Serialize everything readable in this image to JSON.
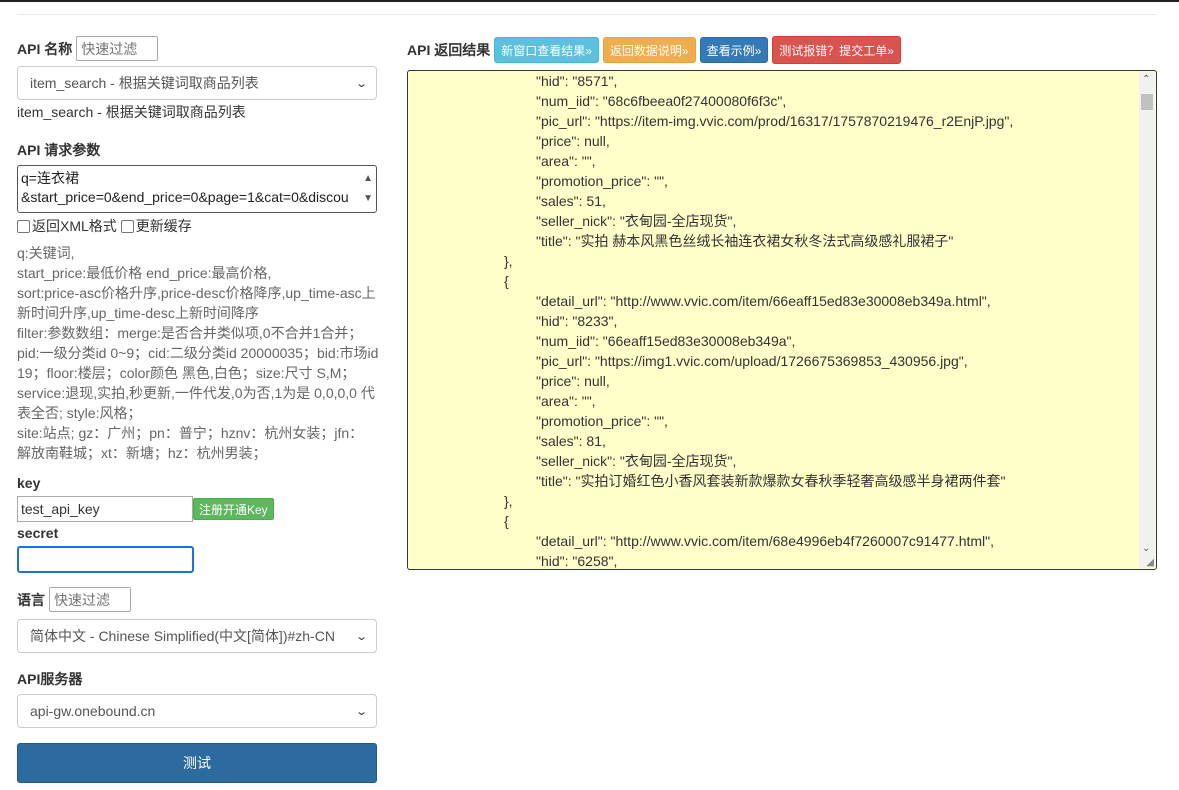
{
  "api_name": {
    "label": "API 名称",
    "filter_placeholder": "快速过滤",
    "selected": "item_search - 根据关键词取商品列表",
    "description": "item_search - 根据关键词取商品列表"
  },
  "request_params": {
    "label": "API 请求参数",
    "line1": "q=连衣裙",
    "line2": "&start_price=0&end_price=0&page=1&cat=0&discou",
    "xml_label": "返回XML格式",
    "cache_label": "更新缓存"
  },
  "help_lines": [
    "q:关键词,",
    "start_price:最低价格 end_price:最高价格,",
    "sort:price-asc价格升序,price-desc价格降序,up_time-asc上",
    "新时间升序,up_time-desc上新时间降序",
    "filter:参数数组：merge:是否合并类似项,0不合并1合并；",
    "pid:一级分类id 0~9；cid:二级分类id 20000035；bid:市场id",
    "19；floor:楼层；color颜色 黑色,白色；size:尺寸 S,M；",
    "service:退现,实拍,秒更新,一件代发,0为否,1为是 0,0,0,0 代",
    "表全否; style:风格；",
    "site:站点; gz：广州；pn：普宁；hznv：杭州女装；jfn：",
    "解放南鞋城；xt：新塘；hz：杭州男装；"
  ],
  "key": {
    "label": "key",
    "value": "test_api_key",
    "register_label": "注册开通Key"
  },
  "secret": {
    "label": "secret",
    "value": ""
  },
  "language": {
    "label": "语言",
    "filter_placeholder": "快速过滤",
    "selected": "简体中文 - Chinese Simplified(中文[简体])#zh-CN"
  },
  "server": {
    "label": "API服务器",
    "selected": "api-gw.onebound.cn"
  },
  "run_button": "测试",
  "result": {
    "label": "API 返回结果",
    "buttons": {
      "new_window": "新窗口查看结果»",
      "data_desc": "返回数据说明»",
      "example": "查看示例»",
      "report": "测试报错？提交工单»"
    },
    "lines": [
      "\t\t\t\t\"hid\": \"8571\",",
      "\t\t\t\t\"num_iid\": \"68c6fbeea0f27400080f6f3c\",",
      "\t\t\t\t\"pic_url\": \"https://item-img.vvic.com/prod/16317/1757870219476_r2EnjP.jpg\",",
      "\t\t\t\t\"price\": null,",
      "\t\t\t\t\"area\": \"\",",
      "\t\t\t\t\"promotion_price\": \"\",",
      "\t\t\t\t\"sales\": 51,",
      "\t\t\t\t\"seller_nick\": \"衣甸园-全店现货\",",
      "\t\t\t\t\"title\": \"实拍 赫本风黑色丝绒长袖连衣裙女秋冬法式高级感礼服裙子\"",
      "\t\t\t},",
      "\t\t\t{",
      "\t\t\t\t\"detail_url\": \"http://www.vvic.com/item/66eaff15ed83e30008eb349a.html\",",
      "\t\t\t\t\"hid\": \"8233\",",
      "\t\t\t\t\"num_iid\": \"66eaff15ed83e30008eb349a\",",
      "\t\t\t\t\"pic_url\": \"https://img1.vvic.com/upload/1726675369853_430956.jpg\",",
      "\t\t\t\t\"price\": null,",
      "\t\t\t\t\"area\": \"\",",
      "\t\t\t\t\"promotion_price\": \"\",",
      "\t\t\t\t\"sales\": 81,",
      "\t\t\t\t\"seller_nick\": \"衣甸园-全店现货\",",
      "\t\t\t\t\"title\": \"实拍订婚红色小香风套装新款爆款女春秋季轻奢高级感半身裙两件套\"",
      "\t\t\t},",
      "\t\t\t{",
      "\t\t\t\t\"detail_url\": \"http://www.vvic.com/item/68e4996eb4f7260007c91477.html\",",
      "\t\t\t\t\"hid\": \"6258\","
    ]
  },
  "icons": {
    "select_arrow": "chevron-down-icon",
    "scroll_up": "arrow-up-icon",
    "scroll_down": "arrow-down-icon",
    "resize": "resize-grip-icon"
  }
}
